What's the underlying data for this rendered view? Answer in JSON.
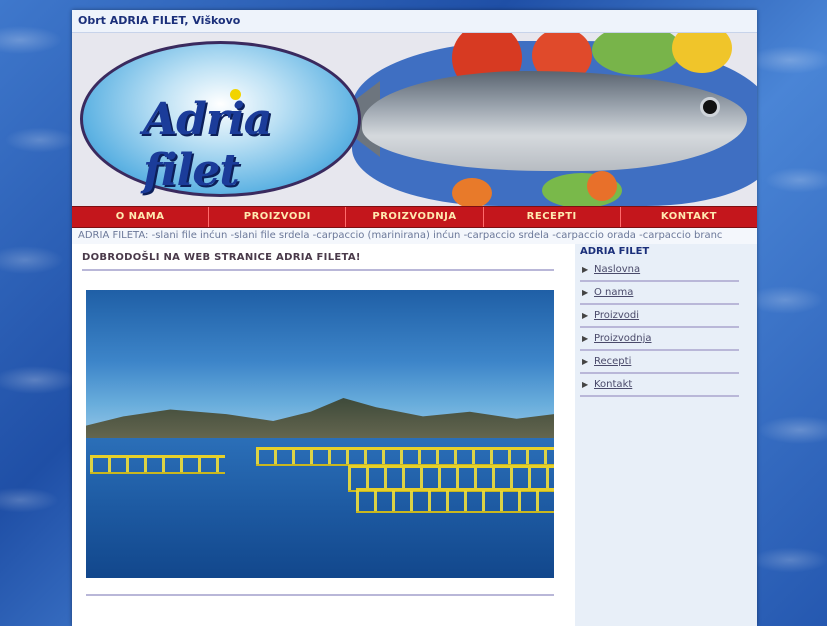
{
  "header": {
    "company_line": "Obrt ADRIA FILET, Viškovo"
  },
  "logo": {
    "text": "Adria filet"
  },
  "nav": {
    "items": [
      {
        "label": "O NAMA"
      },
      {
        "label": "PROIZVODI"
      },
      {
        "label": "PROIZVODNJA"
      },
      {
        "label": "RECEPTI"
      },
      {
        "label": "KONTAKT"
      }
    ]
  },
  "ticker": {
    "text": "ADRIA FILETA: -slani file inćun -slani file srdela -carpaccio (marinirana) inćun -carpaccio srdela -carpaccio orada -carpaccio branc"
  },
  "main": {
    "heading": "DOBRODOŠLI NA WEB STRANICE ADRIA FILETA!"
  },
  "sidebar": {
    "title": "ADRIA FILET",
    "links": [
      {
        "label": "Naslovna"
      },
      {
        "label": "O nama"
      },
      {
        "label": "Proizvodi"
      },
      {
        "label": "Proizvodnja"
      },
      {
        "label": "Recepti"
      },
      {
        "label": "Kontakt"
      }
    ]
  },
  "colors": {
    "nav_red": "#c4161c",
    "nav_text": "#ffe9b0",
    "title_blue": "#1b2f7a"
  }
}
